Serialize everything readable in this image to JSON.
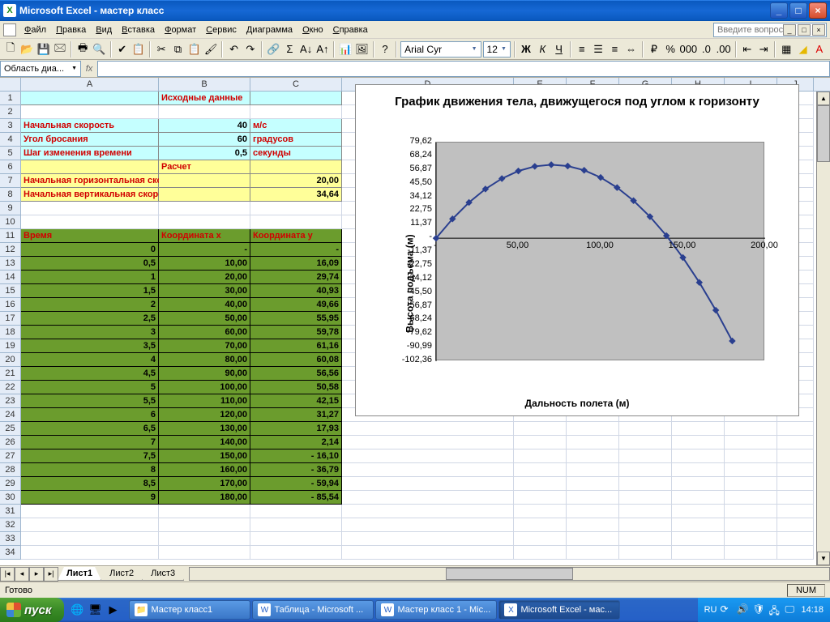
{
  "titlebar": {
    "app": "Microsoft Excel",
    "doc": "мастер класс"
  },
  "menubar": {
    "items": [
      "Файл",
      "Правка",
      "Вид",
      "Вставка",
      "Формат",
      "Сервис",
      "Диаграмма",
      "Окно",
      "Справка"
    ],
    "ask_placeholder": "Введите вопрос"
  },
  "format_toolbar": {
    "font": "Arial Cyr",
    "size": "12"
  },
  "namebox": "Область диа...",
  "fx_label": "fx",
  "columns": [
    "A",
    "B",
    "C",
    "D",
    "E",
    "F",
    "G",
    "H",
    "I",
    "J"
  ],
  "data_block": {
    "r1": {
      "B": "Исходные данные"
    },
    "r3": {
      "A": "Начальная скорость",
      "B": "40",
      "C": "м/с"
    },
    "r4": {
      "A": "Угол бросания",
      "B": "60",
      "C": "градусов"
    },
    "r5": {
      "A": "Шаг изменения времени",
      "B": "0,5",
      "C": "секунды"
    },
    "r6": {
      "B": "Расчет"
    },
    "r7": {
      "A": "Начальная горизонтальная скорость",
      "C": "20,00"
    },
    "r8": {
      "A": "Начальная вертикальная скорость",
      "C": "34,64"
    },
    "r11": {
      "A": "Время",
      "B": "Координата x",
      "C": "Координата y"
    }
  },
  "table": [
    {
      "t": "0",
      "x": "-",
      "y": "-"
    },
    {
      "t": "0,5",
      "x": "10,00",
      "y": "16,09"
    },
    {
      "t": "1",
      "x": "20,00",
      "y": "29,74"
    },
    {
      "t": "1,5",
      "x": "30,00",
      "y": "40,93"
    },
    {
      "t": "2",
      "x": "40,00",
      "y": "49,66"
    },
    {
      "t": "2,5",
      "x": "50,00",
      "y": "55,95"
    },
    {
      "t": "3",
      "x": "60,00",
      "y": "59,78"
    },
    {
      "t": "3,5",
      "x": "70,00",
      "y": "61,16"
    },
    {
      "t": "4",
      "x": "80,00",
      "y": "60,08"
    },
    {
      "t": "4,5",
      "x": "90,00",
      "y": "56,56"
    },
    {
      "t": "5",
      "x": "100,00",
      "y": "50,58"
    },
    {
      "t": "5,5",
      "x": "110,00",
      "y": "42,15"
    },
    {
      "t": "6",
      "x": "120,00",
      "y": "31,27"
    },
    {
      "t": "6,5",
      "x": "130,00",
      "y": "17,93"
    },
    {
      "t": "7",
      "x": "140,00",
      "y": "2,14"
    },
    {
      "t": "7,5",
      "x": "150,00",
      "y": "-   16,10"
    },
    {
      "t": "8",
      "x": "160,00",
      "y": "-   36,79"
    },
    {
      "t": "8,5",
      "x": "170,00",
      "y": "-   59,94"
    },
    {
      "t": "9",
      "x": "180,00",
      "y": "-   85,54"
    }
  ],
  "chart_data": {
    "type": "line",
    "title": "График движения тела, движущегося под углом к горизонту",
    "xlabel": "Дальность полета (м)",
    "ylabel": "Высота подъема (м)",
    "xlim": [
      0,
      200
    ],
    "ylim": [
      -102.36,
      79.62
    ],
    "yticks": [
      "79,62",
      "68,24",
      "56,87",
      "45,50",
      "34,12",
      "22,75",
      "11,37",
      "-",
      "-11,37",
      "-22,75",
      "-34,12",
      "-45,50",
      "-56,87",
      "-68,24",
      "-79,62",
      "-90,99",
      "-102,36"
    ],
    "xticks": [
      "-",
      "50,00",
      "100,00",
      "150,00",
      "200,00"
    ],
    "x": [
      0,
      10,
      20,
      30,
      40,
      50,
      60,
      70,
      80,
      90,
      100,
      110,
      120,
      130,
      140,
      150,
      160,
      170,
      180
    ],
    "y": [
      0,
      16.09,
      29.74,
      40.93,
      49.66,
      55.95,
      59.78,
      61.16,
      60.08,
      56.56,
      50.58,
      42.15,
      31.27,
      17.93,
      2.14,
      -16.1,
      -36.79,
      -59.94,
      -85.54
    ]
  },
  "sheets": [
    "Лист1",
    "Лист2",
    "Лист3"
  ],
  "active_sheet": 0,
  "status": {
    "ready": "Готово",
    "num": "NUM"
  },
  "taskbar": {
    "start": "пуск",
    "tasks": [
      {
        "label": "Мастер класс1",
        "icon": "📁"
      },
      {
        "label": "Таблица - Microsoft ...",
        "icon": "W"
      },
      {
        "label": "Мастер класс 1 - Mic...",
        "icon": "W"
      },
      {
        "label": "Microsoft Excel - мас...",
        "icon": "X",
        "active": true
      }
    ],
    "lang": "RU",
    "clock": "14:18"
  }
}
